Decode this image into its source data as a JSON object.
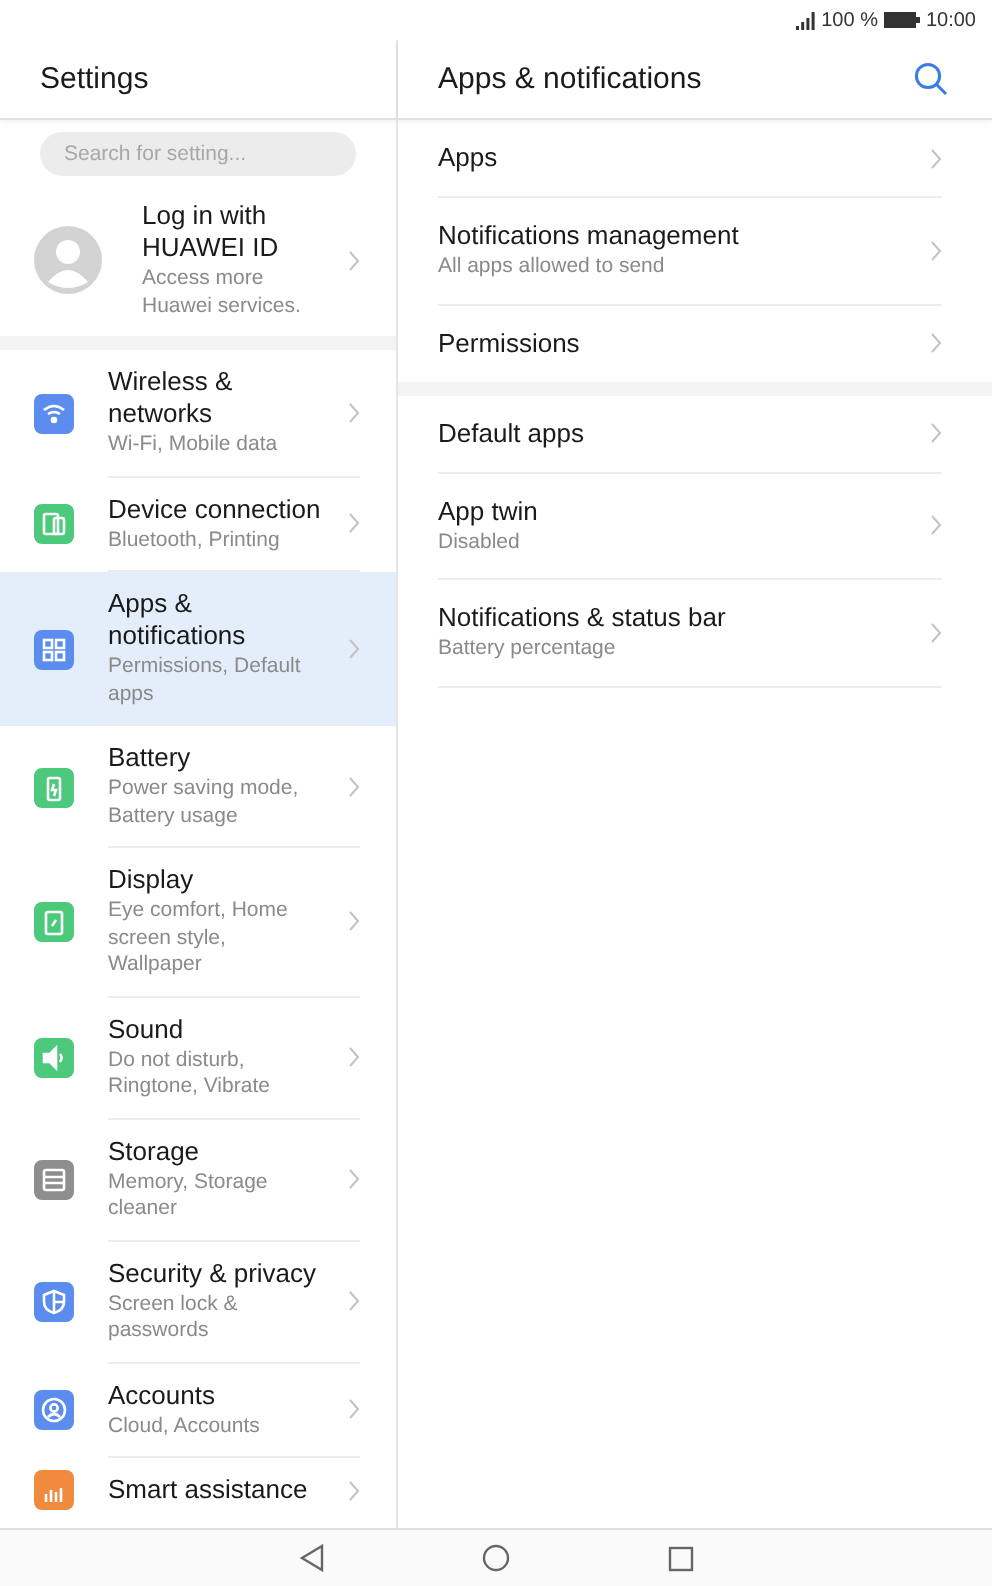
{
  "status_bar": {
    "battery_text": "100 %",
    "time": "10:00"
  },
  "sidebar": {
    "title": "Settings",
    "search": {
      "placeholder": "Search for setting..."
    },
    "account": {
      "title": "Log in with HUAWEI ID",
      "subtitle": "Access more Huawei services."
    },
    "items": [
      {
        "title": "Wireless & networks",
        "subtitle": "Wi-Fi, Mobile data",
        "color": "#5b8def",
        "selected": false
      },
      {
        "title": "Device connection",
        "subtitle": "Bluetooth, Printing",
        "color": "#4cc97a",
        "selected": false
      },
      {
        "title": "Apps & notifications",
        "subtitle": "Permissions, Default apps",
        "color": "#5b8def",
        "selected": true
      },
      {
        "title": "Battery",
        "subtitle": "Power saving mode, Battery usage",
        "color": "#4cc97a",
        "selected": false
      },
      {
        "title": "Display",
        "subtitle": "Eye comfort, Home screen style, Wallpaper",
        "color": "#4cc97a",
        "selected": false
      },
      {
        "title": "Sound",
        "subtitle": "Do not disturb, Ringtone, Vibrate",
        "color": "#4cc97a",
        "selected": false
      },
      {
        "title": "Storage",
        "subtitle": "Memory, Storage cleaner",
        "color": "#8e8e8e",
        "selected": false
      },
      {
        "title": "Security & privacy",
        "subtitle": "Screen lock & passwords",
        "color": "#5b8def",
        "selected": false
      },
      {
        "title": "Accounts",
        "subtitle": "Cloud, Accounts",
        "color": "#5b8def",
        "selected": false
      },
      {
        "title": "Smart assistance",
        "color": "#f08a3c",
        "selected": false
      }
    ]
  },
  "detail": {
    "title": "Apps & notifications",
    "groups": [
      [
        {
          "title": "Apps"
        },
        {
          "title": "Notifications management",
          "subtitle": "All apps allowed to send"
        },
        {
          "title": "Permissions"
        }
      ],
      [
        {
          "title": "Default apps"
        },
        {
          "title": "App twin",
          "subtitle": "Disabled"
        },
        {
          "title": "Notifications & status bar",
          "subtitle": "Battery percentage"
        }
      ]
    ]
  }
}
